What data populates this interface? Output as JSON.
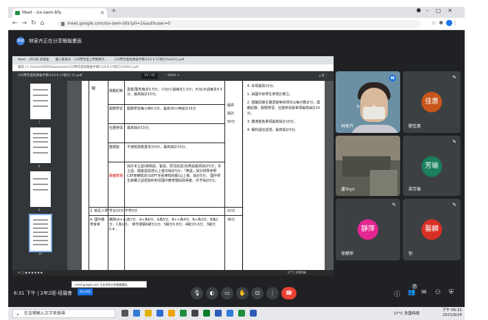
{
  "browser": {
    "tab_title": "Meet - six-swm-bfa",
    "url": "meet.google.com/six-swm-bfa?pli=1&authuser=0"
  },
  "meet": {
    "presenter_initials": "林家",
    "presenting_text": "林家卉正在分享簡報畫面",
    "time": "6:31 下午",
    "meeting_code": "2年2班-班親會",
    "participants_badge": "7",
    "chat_badge": "1"
  },
  "shared_screen": {
    "inner_tabs": [
      "Meet - 1年2班 班親會",
      "國小家長日 - 110學年度上學期親子...",
      "110學年度班親會手冊(110.9.17修訂)%20(1).pdf"
    ],
    "inner_url": "檔案  |  C:/Users/USER/Downloads/110學年度班親會手冊(110.9.17修訂)%20(1).pdf",
    "pdf_filename": "110學年度班親會手冊(110.9.17修訂) (1).pdf",
    "page_indicator": "15 / 41",
    "zoom": "100%",
    "thumb_numbers": [
      "7",
      "8",
      "9",
      "10"
    ],
    "rows": [
      {
        "label": "獎勵紀錄",
        "text": "嘉獎/警告每支0.5分；小功/小過每支1.5分；大功/大過每支4.5分，最高採計15分。"
      },
      {
        "label": "服務學習",
        "text": "服務學習每小時0.5分，最高30小時採計15分"
      },
      {
        "label": "社團參與",
        "text": "最高採計15分。"
      },
      {
        "label": "體適能",
        "text": "不通檢測者基本分0分，最高採計10分。"
      },
      {
        "label": "績優表現",
        "text": "採計本土語(閩南語、客語、原住民語)及英語最高採計5分；本土語、閩客語認證以上者均採計5分；「英語」採計標準參照CEF架構檢定(GEPT全民英檢初級)以上者，採計5分。 國中學生競賽之認證資料和非國中教育階段取得者，亦予採計5分。"
      }
    ],
    "side_col_text": "最高採計50分",
    "row3_label": "3. 就近入學",
    "row3_text": "符合10分  不符0分",
    "row3_score": "10分",
    "row4_label": "4. 國中教育會考",
    "row4_text": "精熟(A++)為7分、A+為6分、A為5分、B++為4分、B+為3分、B為2分、C為1分。 寫作測驗6級分1分、5級分0.8分、4級分0.6分、3級分0.4...",
    "row4_score": "36分",
    "right_col": [
      "4. 本項最高10分。",
      "1. 由國中依學生表現計算之。",
      "2. 獎勵紀錄主體透能等四項均以每分數計分，獎勵紀錄、服務學習、社團參與各單項最高採計15分。",
      "3. 體適能各單項最高採計10分。",
      "4. 權利讓言認證，最高採計5分。"
    ],
    "notification_text": "meet.google.com 正在與你分享螢幕畫面。",
    "notification_btn": "停止共用",
    "taskbar_right": "27°C 多雲時晴"
  },
  "tiles": [
    {
      "name": "林家卉",
      "type": "video"
    },
    {
      "name": "劉佳惠",
      "initial": "佳惠",
      "color": "#c8551b"
    },
    {
      "name": "盧Yoyo",
      "type": "video"
    },
    {
      "name": "梁芳瑜",
      "initial": "芳瑜",
      "color": "#1a7f5a"
    },
    {
      "name": "徐靜萍",
      "initial": "靜萍",
      "color": "#e52592"
    },
    {
      "name": "你",
      "initial": "馨麟",
      "color": "#d93025"
    }
  ],
  "taskbar": {
    "search_placeholder": "在這裡輸入文字來搜尋",
    "weather": "27°C 多雲時晴",
    "clock_time": "下午 06:31",
    "clock_date": "2021/9/24"
  }
}
